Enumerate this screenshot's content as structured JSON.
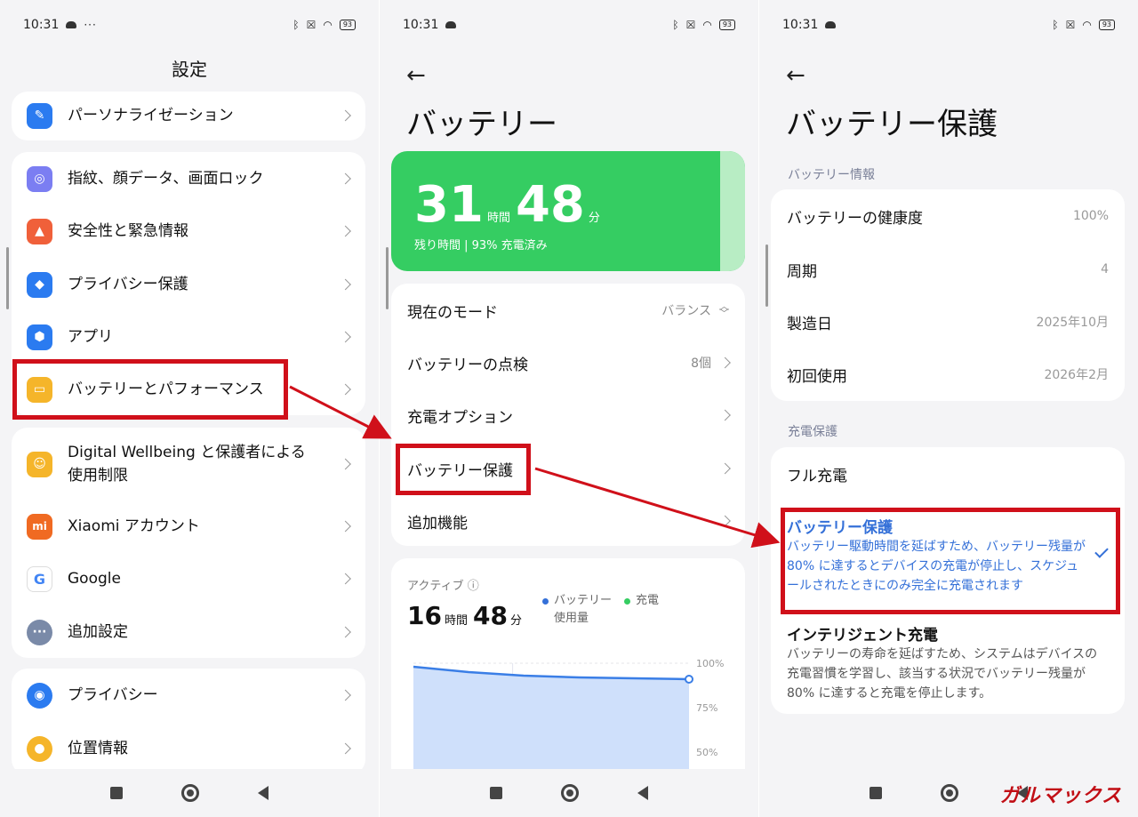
{
  "status": {
    "time": "10:31",
    "dots": "···",
    "battery": "93"
  },
  "screen1": {
    "title": "設定",
    "items": [
      {
        "label": "パーソナライゼーション",
        "icon": "personalization-icon",
        "color": "#2b7bf0"
      },
      {
        "label": "指紋、顔データ、画面ロック",
        "icon": "fingerprint-icon",
        "color": "#7b7ef2"
      },
      {
        "label": "安全性と緊急情報",
        "icon": "emergency-icon",
        "color": "#f0603a"
      },
      {
        "label": "プライバシー保護",
        "icon": "privacy-protection-icon",
        "color": "#2b7bf0"
      },
      {
        "label": "アプリ",
        "icon": "apps-icon",
        "color": "#2b7bf0"
      },
      {
        "label": "バッテリーとパフォーマンス",
        "icon": "battery-icon",
        "color": "#f5b52a"
      },
      {
        "label": "Digital Wellbeing と保護者による使用制限",
        "icon": "wellbeing-icon",
        "color": "#f5b52a"
      },
      {
        "label": "Xiaomi アカウント",
        "icon": "xiaomi-icon",
        "color": "#f06a22"
      },
      {
        "label": "Google",
        "icon": "google-icon",
        "color": "#ffffff"
      },
      {
        "label": "追加設定",
        "icon": "more-settings-icon",
        "color": "#7a8aa8"
      },
      {
        "label": "プライバシー",
        "icon": "eye-icon",
        "color": "#2b7bf0"
      },
      {
        "label": "位置情報",
        "icon": "location-icon",
        "color": "#f5b52a"
      }
    ]
  },
  "screen2": {
    "title": "バッテリー",
    "hours": "31",
    "hours_unit": "時間",
    "minutes": "48",
    "minutes_unit": "分",
    "remaining": "残り時間 | 93% 充電済み",
    "rows": [
      {
        "label": "現在のモード",
        "value": "バランス"
      },
      {
        "label": "バッテリーの点検",
        "value": "8個"
      },
      {
        "label": "充電オプション",
        "value": ""
      },
      {
        "label": "バッテリー保護",
        "value": ""
      },
      {
        "label": "追加機能",
        "value": ""
      }
    ],
    "active_label": "アクティブ",
    "active_hours": "16",
    "active_hours_unit": "時間",
    "active_minutes": "48",
    "active_minutes_unit": "分",
    "legend_usage": "バッテリー使用量",
    "legend_charge": "充電",
    "chart_data": {
      "type": "area",
      "series": [
        {
          "name": "バッテリー使用量",
          "values": [
            98,
            95,
            93,
            92,
            91.5,
            91
          ]
        }
      ],
      "ylim": [
        40,
        100
      ],
      "y_ticks": [
        "100%",
        "75%",
        "50%"
      ],
      "grid": true
    }
  },
  "screen3": {
    "title": "バッテリー保護",
    "info_label": "バッテリー情報",
    "info": [
      {
        "k": "バッテリーの健康度",
        "v": "100%"
      },
      {
        "k": "周期",
        "v": "4"
      },
      {
        "k": "製造日",
        "v": "2025年10月"
      },
      {
        "k": "初回使用",
        "v": "2026年2月"
      }
    ],
    "protect_label": "充電保護",
    "full_charge": "フル充電",
    "opt_title": "バッテリー保護",
    "opt_desc": "バッテリー駆動時間を延ばすため、バッテリー残量が 80% に達するとデバイスの充電が停止し、スケジュールされたときにのみ完全に充電されます",
    "smart_title": "インテリジェント充電",
    "smart_desc": "バッテリーの寿命を延ばすため、システムはデバイスの充電習慣を学習し、該当する状況でバッテリー残量が 80% に達すると充電を停止します。",
    "watermark": "ガルマックス"
  },
  "colors": {
    "accent": "#3470d8",
    "highlight": "#d0101a",
    "battery_green": "#35cd62"
  }
}
